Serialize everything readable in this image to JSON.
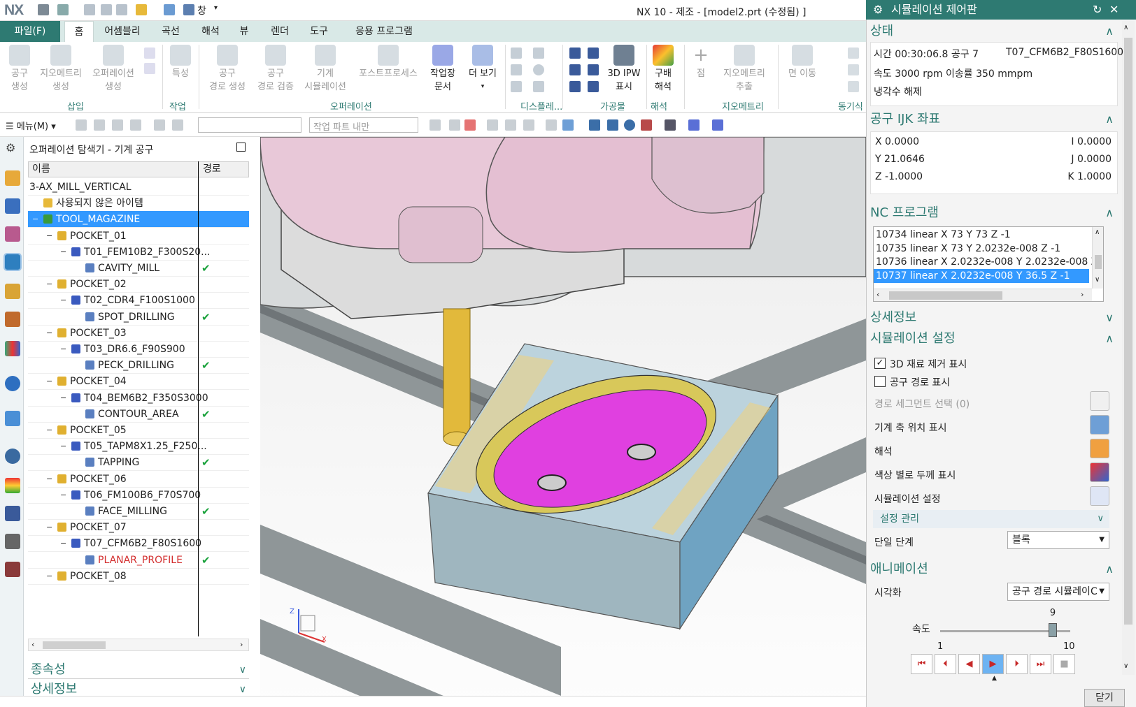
{
  "app": {
    "logo": "NX",
    "window_title": "NX 10 - 제조 - [model2.prt (수정됨) ]",
    "quick_window_menu": "창"
  },
  "menu": {
    "file": "파일(F)",
    "tabs": [
      "홈",
      "어셈블리",
      "곡선",
      "해석",
      "뷰",
      "렌더",
      "도구",
      "응용 프로그램"
    ]
  },
  "ribbon": {
    "buttons": [
      {
        "label": "공구\n생성",
        "enabled": false
      },
      {
        "label": "지오메트리\n생성",
        "enabled": false
      },
      {
        "label": "오퍼레이션\n생성",
        "enabled": false
      },
      {
        "label": "특성",
        "enabled": false
      },
      {
        "label": "공구\n경로 생성",
        "enabled": false
      },
      {
        "label": "공구\n경로 검증",
        "enabled": false
      },
      {
        "label": "기계\n시뮬레이션",
        "enabled": false
      },
      {
        "label": "포스트프로세스",
        "enabled": false
      },
      {
        "label": "작업장\n문서",
        "enabled": true
      },
      {
        "label": "더 보기",
        "enabled": true
      },
      {
        "label": "3D IPW\n표시",
        "enabled": true
      },
      {
        "label": "구배\n해석",
        "enabled": true
      },
      {
        "label": "점",
        "enabled": false
      },
      {
        "label": "지오메트리\n추출",
        "enabled": false
      },
      {
        "label": "면 이동",
        "enabled": false
      }
    ],
    "groups": [
      "삽입",
      "작업",
      "오퍼레이션",
      "디스플레...",
      "가공물",
      "해석",
      "지오메트리",
      "동기식"
    ]
  },
  "toolbar2": {
    "menu_label": "메뉴(M)",
    "combo1_value": "",
    "combo2_placeholder": "작업 파트 내만"
  },
  "navigator": {
    "title": "오퍼레이션 탐색기 - 기계 공구",
    "columns": [
      "이름",
      "경로"
    ],
    "rows": [
      {
        "text": "3-AX_MILL_VERTICAL",
        "level": 0,
        "kind": "root",
        "check": ""
      },
      {
        "text": "사용되지 않은 아이템",
        "level": 1,
        "kind": "unused",
        "check": ""
      },
      {
        "text": "TOOL_MAGAZINE",
        "level": 1,
        "kind": "magazine",
        "check": "",
        "selected": true
      },
      {
        "text": "POCKET_01",
        "level": 2,
        "kind": "pocket",
        "check": ""
      },
      {
        "text": "T01_FEM10B2_F300S20...",
        "level": 3,
        "kind": "tool",
        "check": ""
      },
      {
        "text": "CAVITY_MILL",
        "level": 4,
        "kind": "op",
        "check": "✔"
      },
      {
        "text": "POCKET_02",
        "level": 2,
        "kind": "pocket",
        "check": ""
      },
      {
        "text": "T02_CDR4_F100S1000",
        "level": 3,
        "kind": "tool",
        "check": ""
      },
      {
        "text": "SPOT_DRILLING",
        "level": 4,
        "kind": "op",
        "check": "✔"
      },
      {
        "text": "POCKET_03",
        "level": 2,
        "kind": "pocket",
        "check": ""
      },
      {
        "text": "T03_DR6.6_F90S900",
        "level": 3,
        "kind": "tool",
        "check": ""
      },
      {
        "text": "PECK_DRILLING",
        "level": 4,
        "kind": "op",
        "check": "✔"
      },
      {
        "text": "POCKET_04",
        "level": 2,
        "kind": "pocket",
        "check": ""
      },
      {
        "text": "T04_BEM6B2_F350S3000",
        "level": 3,
        "kind": "tool",
        "check": ""
      },
      {
        "text": "CONTOUR_AREA",
        "level": 4,
        "kind": "op",
        "check": "✔"
      },
      {
        "text": "POCKET_05",
        "level": 2,
        "kind": "pocket",
        "check": ""
      },
      {
        "text": "T05_TAPM8X1.25_F250...",
        "level": 3,
        "kind": "tool",
        "check": ""
      },
      {
        "text": "TAPPING",
        "level": 4,
        "kind": "op",
        "check": "✔"
      },
      {
        "text": "POCKET_06",
        "level": 2,
        "kind": "pocket",
        "check": ""
      },
      {
        "text": "T06_FM100B6_F70S700",
        "level": 3,
        "kind": "tool",
        "check": ""
      },
      {
        "text": "FACE_MILLING",
        "level": 4,
        "kind": "op",
        "check": "✔"
      },
      {
        "text": "POCKET_07",
        "level": 2,
        "kind": "pocket",
        "check": ""
      },
      {
        "text": "T07_CFM6B2_F80S1600",
        "level": 3,
        "kind": "tool",
        "check": ""
      },
      {
        "text": "PLANAR_PROFILE",
        "level": 4,
        "kind": "op-active",
        "check": "✔"
      },
      {
        "text": "POCKET_08",
        "level": 2,
        "kind": "pocket",
        "check": ""
      }
    ],
    "panels": [
      "종속성",
      "상세정보"
    ]
  },
  "viewport": {
    "triad": {
      "x": "X",
      "z": "Z"
    }
  },
  "sim_panel": {
    "title": "시뮬레이션 제어판",
    "status": {
      "header": "상태",
      "time": "시간 00:30:06.8 공구 7",
      "tool": "T07_CFM6B2_F80S1600",
      "speed": "속도 3000 rpm 이송률 350 mmpm",
      "coolant": "냉각수 해제"
    },
    "ijk": {
      "header": "공구 IJK 좌표",
      "x": "X 0.0000",
      "y": "Y 21.0646",
      "z": "Z -1.0000",
      "i": "I 0.0000",
      "j": "J 0.0000",
      "k": "K 1.0000"
    },
    "nc": {
      "header": "NC 프로그램",
      "lines": [
        "10734 linear X 73 Y 73 Z -1",
        "10735 linear X 73 Y 2.0232e-008 Z -1",
        "10736 linear X 2.0232e-008 Y 2.0232e-008 Z -1",
        "10737 linear X 2.0232e-008 Y 36.5 Z -1"
      ],
      "selected_index": 3
    },
    "details_header": "상세정보",
    "settings": {
      "header": "시뮬레이션 설정",
      "show_3d": "3D 재료 제거 표시",
      "show_3d_checked": true,
      "show_path": "공구 경로 표시",
      "show_path_checked": false,
      "segment": "경로 세그먼트 선택 (0)",
      "axis_pos": "기계 축 위치 표시",
      "analysis": "해석",
      "thickness": "색상 별로 두께 표시",
      "sim_settings": "시뮬레이션 설정",
      "manage": "설정 관리",
      "single_step": "단일 단계",
      "single_step_value": "블록"
    },
    "animation": {
      "header": "애니메이션",
      "visualize": "시각화",
      "visualize_value": "공구 경로 시뮬레이C",
      "speed_label": "속도",
      "speed_value": 9,
      "speed_min": 1,
      "speed_max": 10,
      "speed_value_label": "9",
      "speed_min_label": "1",
      "speed_max_label": "10"
    },
    "close": "닫기"
  },
  "colors": {
    "accent": "#2e7a72",
    "selection": "#3399ff",
    "check": "#18a13a",
    "active_op": "#d32f2f",
    "stock_blue": "#bcd3dd",
    "cut_magenta": "#e040e0",
    "tool_gold": "#e2b93b",
    "spindle_pink": "#e8c8d8"
  }
}
